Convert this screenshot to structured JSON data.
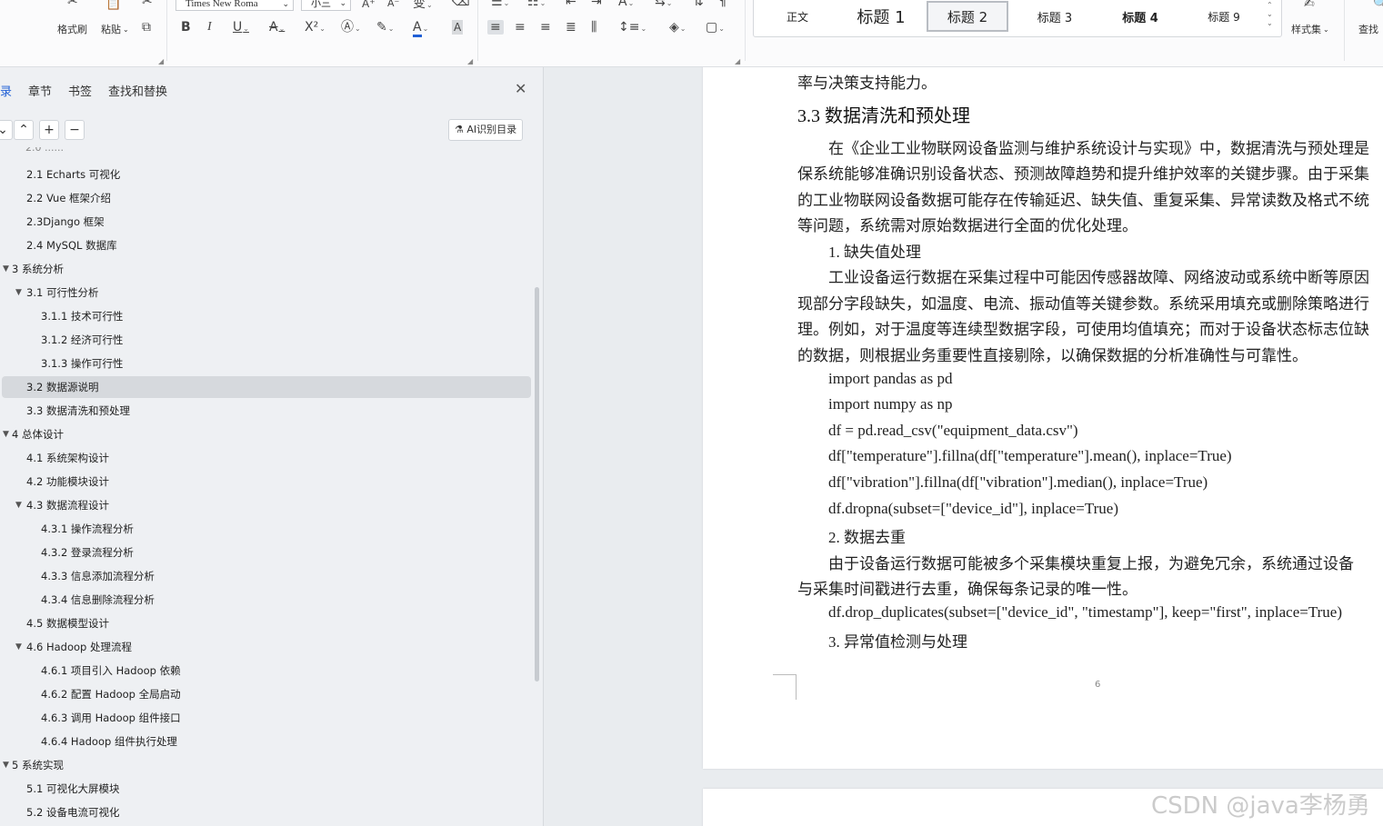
{
  "ribbon": {
    "clipboard": {
      "format_painter": "格式刷",
      "paste": "粘贴"
    },
    "font": {
      "family": "Times New Roma",
      "size": "小三"
    },
    "styles": {
      "items": [
        "正文",
        "标题 1",
        "标题 2",
        "标题 3",
        "标题 4",
        "标题 9"
      ],
      "selected": "标题 2",
      "style_set": "样式集",
      "find": "查找"
    }
  },
  "nav": {
    "tabs": [
      "录",
      "章节",
      "书签",
      "查找和替换"
    ],
    "active_tab": "录",
    "ai_button": "AI识别目录",
    "toc": [
      {
        "label": "2.1 Echarts 可视化",
        "level": 2
      },
      {
        "label": "2.2 Vue 框架介绍",
        "level": 2
      },
      {
        "label": "2.3Django 框架",
        "level": 2
      },
      {
        "label": "2.4 MySQL 数据库",
        "level": 2
      },
      {
        "label": "3 系统分析",
        "level": 1,
        "expanded": true
      },
      {
        "label": "3.1  可行性分析",
        "level": 2,
        "expanded": true
      },
      {
        "label": "3.1.1  技术可行性",
        "level": 3
      },
      {
        "label": "3.1.2  经济可行性",
        "level": 3
      },
      {
        "label": "3.1.3  操作可行性",
        "level": 3
      },
      {
        "label": "3.2 数据源说明",
        "level": 2,
        "selected": true
      },
      {
        "label": "3.3 数据清洗和预处理",
        "level": 2
      },
      {
        "label": "4 总体设计",
        "level": 1,
        "expanded": true
      },
      {
        "label": "4.1 系统架构设计",
        "level": 2
      },
      {
        "label": "4.2 功能模块设计",
        "level": 2
      },
      {
        "label": "4.3 数据流程设计",
        "level": 2,
        "expanded": true
      },
      {
        "label": "4.3.1 操作流程分析",
        "level": 3
      },
      {
        "label": "4.3.2 登录流程分析",
        "level": 3
      },
      {
        "label": "4.3.3 信息添加流程分析",
        "level": 3
      },
      {
        "label": "4.3.4 信息删除流程分析",
        "level": 3
      },
      {
        "label": "4.5  数据模型设计",
        "level": 2
      },
      {
        "label": "4.6 Hadoop 处理流程",
        "level": 2,
        "expanded": true
      },
      {
        "label": "4.6.1  项目引入 Hadoop 依赖",
        "level": 3
      },
      {
        "label": "4.6.2  配置 Hadoop 全局启动",
        "level": 3
      },
      {
        "label": "4.6.3  调用 Hadoop 组件接口",
        "level": 3
      },
      {
        "label": "4.6.4 Hadoop 组件执行处理",
        "level": 3
      },
      {
        "label": "5 系统实现",
        "level": 1,
        "expanded": true
      },
      {
        "label": "5.1  可视化大屏模块",
        "level": 2
      },
      {
        "label": "5.2  设备电流可视化",
        "level": 2
      }
    ]
  },
  "document": {
    "lines": [
      {
        "text": "率与决策支持能力。",
        "kind": "body"
      },
      {
        "text": "3.3 数据清洗和预处理",
        "kind": "heading"
      },
      {
        "text": "在《企业工业物联网设备监测与维护系统设计与实现》中，数据清洗与预处理是",
        "kind": "indent"
      },
      {
        "text": "保系统能够准确识别设备状态、预测故障趋势和提升维护效率的关键步骤。由于采集",
        "kind": "body"
      },
      {
        "text": "的工业物联网设备数据可能存在传输延迟、缺失值、重复采集、异常读数及格式不统",
        "kind": "body"
      },
      {
        "text": "等问题，系统需对原始数据进行全面的优化处理。",
        "kind": "body"
      },
      {
        "text": "1.  缺失值处理",
        "kind": "indent"
      },
      {
        "text": "工业设备运行数据在采集过程中可能因传感器故障、网络波动或系统中断等原因",
        "kind": "indent"
      },
      {
        "text": "现部分字段缺失，如温度、电流、振动值等关键参数。系统采用填充或删除策略进行",
        "kind": "body"
      },
      {
        "text": "理。例如，对于温度等连续型数据字段，可使用均值填充；而对于设备状态标志位缺",
        "kind": "body"
      },
      {
        "text": "的数据，则根据业务重要性直接剔除，以确保数据的分析准确性与可靠性。",
        "kind": "body"
      },
      {
        "text": "import pandas as pd",
        "kind": "indent"
      },
      {
        "text": "import numpy as np",
        "kind": "indent"
      },
      {
        "text": "df = pd.read_csv(\"equipment_data.csv\")",
        "kind": "indent"
      },
      {
        "text": "df[\"temperature\"].fillna(df[\"temperature\"].mean(), inplace=True)",
        "kind": "indent"
      },
      {
        "text": "df[\"vibration\"].fillna(df[\"vibration\"].median(), inplace=True)",
        "kind": "indent"
      },
      {
        "text": "df.dropna(subset=[\"device_id\"], inplace=True)",
        "kind": "indent"
      },
      {
        "text": "2.  数据去重",
        "kind": "indent"
      },
      {
        "text": "由于设备运行数据可能被多个采集模块重复上报，为避免冗余，系统通过设备",
        "kind": "indent"
      },
      {
        "text": "与采集时间戳进行去重，确保每条记录的唯一性。",
        "kind": "body"
      },
      {
        "text": "df.drop_duplicates(subset=[\"device_id\", \"timestamp\"], keep=\"first\", inplace=True)",
        "kind": "indent"
      },
      {
        "text": "3.  异常值检测与处理",
        "kind": "indent"
      }
    ],
    "page_number": "6"
  },
  "watermark": "CSDN @java李杨勇",
  "colors": {
    "accent": "#1f5fd6",
    "font_color_bar": "#1f5fd6",
    "selected_row": "#d6d9dd"
  }
}
